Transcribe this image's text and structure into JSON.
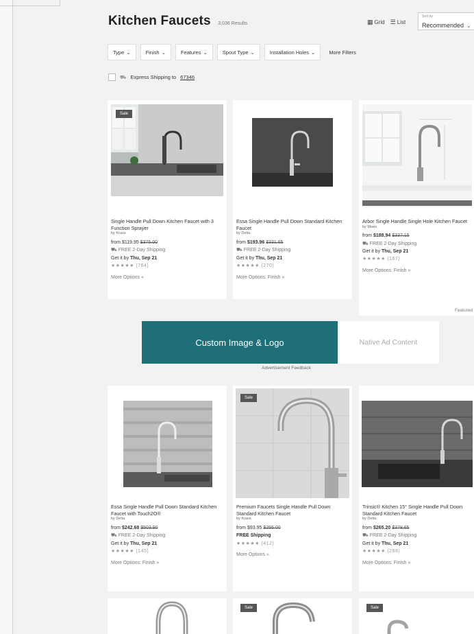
{
  "header": {
    "title": "Kitchen Faucets",
    "count": "3,036 Results"
  },
  "view": {
    "grid": "Grid",
    "list": "List"
  },
  "sort": {
    "label": "Sort by",
    "value": "Recommended"
  },
  "filters": [
    "Type",
    "Finish",
    "Features",
    "Spout Type",
    "Installation Holes"
  ],
  "more_filters": "More Filters",
  "express": {
    "text": "Express Shipping to",
    "zip": "67346"
  },
  "products": [
    {
      "sale": "Sale",
      "name": "Single Handle Pull Down Kitchen Faucet with 3 Function Sprayer",
      "brand": "by Kraus",
      "price_prefix": "from ",
      "price": "$119.95",
      "was": "$375.00",
      "shipping": "FREE 2-Day Shipping",
      "get_prefix": "Get it by ",
      "get_date": "Thu, Sep 21",
      "stars": "★★★★★",
      "reviews": "(764)",
      "options": "More Options »"
    },
    {
      "sale": "",
      "name": "Essa Single Handle Pull Down Standard Kitchen Faucet",
      "brand": "by Delta",
      "price_prefix": "from ",
      "price": "$193.96",
      "was": "$331.65",
      "shipping": "FREE 2-Day Shipping",
      "get_prefix": "Get it by ",
      "get_date": "Thu, Sep 21",
      "stars": "★★★★★",
      "reviews": "(270)",
      "options": "More Options: Finish »"
    },
    {
      "sale": "",
      "name": "Arbor Single Handle Single Hole Kitchen Faucet",
      "brand": "by Moen",
      "price_prefix": "from ",
      "price": "$188.94",
      "was": "$337.15",
      "shipping": "FREE 2-Day Shipping",
      "get_prefix": "Get it by ",
      "get_date": "Thu, Sep 21",
      "stars": "★★★★★",
      "reviews": "(167)",
      "options": "More Options: Finish »"
    },
    {
      "sale": "",
      "name": "Essa Single Handle Pull Down Standard Kitchen Faucet with Touch2O®",
      "brand": "by Delta",
      "price_prefix": "from ",
      "price": "$242.68",
      "was": "$503.90",
      "shipping": "FREE 2-Day Shipping",
      "get_prefix": "Get it by ",
      "get_date": "Thu, Sep 21",
      "stars": "★★★★★",
      "reviews": "(145)",
      "options": "More Options: Finish »"
    },
    {
      "sale": "Sale",
      "name": "Premium Faucets Single Handle Pull Down Standard Kitchen Faucet",
      "brand": "by Kraus",
      "price_prefix": "from ",
      "price": "$93.95",
      "was": "$255.00",
      "shipping": "FREE Shipping",
      "get_prefix": "",
      "get_date": "",
      "stars": "★★★★★",
      "reviews": "(412)",
      "options": "More Options »"
    },
    {
      "sale": "",
      "name": "Trinsic® Kitchen 15° Single Handle Pull Down Standard Kitchen Faucet",
      "brand": "by Delta",
      "price_prefix": "from ",
      "price": "$265.20",
      "was": "$378.65",
      "shipping": "FREE 2-Day Shipping",
      "get_prefix": "Get it by ",
      "get_date": "Thu, Sep 21",
      "stars": "★★★★★",
      "reviews": "(298)",
      "options": "More Options: Finish »"
    },
    {
      "sale": ""
    },
    {
      "sale": "Sale"
    },
    {
      "sale": "Sale"
    }
  ],
  "featured": "Featured",
  "ad": {
    "custom": "Custom Image & Logo",
    "native": "Native Ad Content",
    "feedback": "Advertisement Feedback"
  },
  "colors": {
    "ad_teal": "#1f6f78",
    "sale_badge": "#555555"
  }
}
